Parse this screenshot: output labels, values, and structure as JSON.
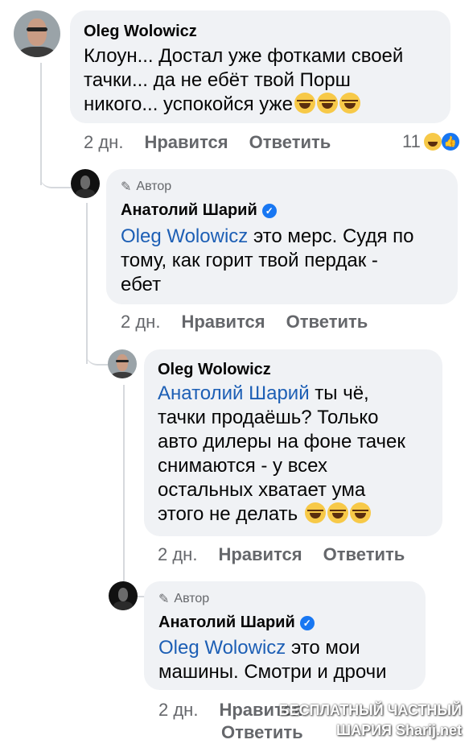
{
  "comments": [
    {
      "name": "Oleg Wolowicz",
      "avatar": "person-photo-avatar",
      "text_lines": [
        "Клоун... Достал уже фотками своей",
        "тачки... да не ебёт твой Порш",
        "никого... успокойся уже"
      ],
      "emoji_count": 3,
      "time": "2 дн.",
      "like_label": "Нравится",
      "reply_label": "Ответить",
      "reaction_count": "11"
    },
    {
      "author_tag": "Автор",
      "name": "Анатолий Шарий",
      "verified": true,
      "mention": "Oleg Wolowicz",
      "text_lines": [
        " это мерс. Судя по",
        "тому, как горит твой пердак -",
        "ебет"
      ],
      "time": "2 дн.",
      "like_label": "Нравится",
      "reply_label": "Ответить"
    },
    {
      "name": "Oleg Wolowicz",
      "mention": "Анатолий Шарий",
      "text_lines": [
        " ты чё,",
        "тачки продаёшь? Только",
        "авто дилеры на фоне тачек",
        "снимаются - у всех",
        "остальных хватает ума",
        "этого не делать"
      ],
      "emoji_count": 3,
      "time": "2 дн.",
      "like_label": "Нравится",
      "reply_label": "Ответить"
    },
    {
      "author_tag": "Автор",
      "name": "Анатолий Шарий",
      "verified": true,
      "mention": "Oleg Wolowicz",
      "text_lines": [
        " это мои",
        "машины. Смотри и дрочи"
      ],
      "time": "2 дн.",
      "like_label": "Нравится",
      "reply_label": "Ответить"
    }
  ],
  "watermark": {
    "line1": "БЕСПЛАТНЫЙ ЧАСТНЫЙ",
    "line2": "ШАРИЯ Sharij.net"
  },
  "colors": {
    "bubble": "#f0f2f5",
    "link": "#1d5fb5",
    "meta": "#65676b",
    "verified": "#1877f2"
  }
}
